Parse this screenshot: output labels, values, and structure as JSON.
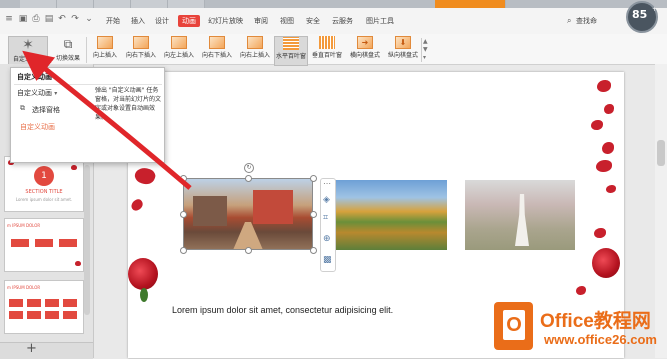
{
  "titlebar": {
    "tabs": [
      "",
      "",
      "",
      "",
      "",
      ""
    ]
  },
  "quick_access": {
    "icons": [
      "menu-icon",
      "save-icon",
      "print-icon",
      "preview-icon",
      "undo-icon",
      "redo-icon",
      "more-icon"
    ]
  },
  "menu": {
    "items": [
      "开始",
      "插入",
      "设计",
      "动画",
      "幻灯片放映",
      "审阅",
      "视图",
      "安全",
      "云服务",
      "图片工具"
    ],
    "active": "动画",
    "search_label": "查找命"
  },
  "badge": {
    "value": "85",
    "unit": "+"
  },
  "ribbon": {
    "custom_anim": "自定义动画",
    "transition": "切换效果",
    "effects": [
      "向上插入",
      "向右下插入",
      "向左上插入",
      "向右下插入",
      "向右上插入",
      "水平百叶窗",
      "垂直百叶窗",
      "横向棋盘式",
      "纵向棋盘式"
    ]
  },
  "popup": {
    "title": "自定义动画",
    "dropdown_label": "自定义动画",
    "pane_option": "选择窗格",
    "link": "自定义动画",
    "description": "弹出 \"自定义动画\" 任务窗格，对当前幻灯片的文字或对象设置自动画效果。"
  },
  "thumbs": {
    "section_num": "1",
    "section_title": "SECTION TITLE",
    "lorem": "Lorem ipsum dolor sit amet.",
    "ipsum": "m IPSUM DOLOR"
  },
  "slide": {
    "body_text": "Lorem ipsum dolor sit amet, consectetur adipisicing elit."
  },
  "float_tools": {
    "icons": [
      "more-icon",
      "layers-icon",
      "crop-icon",
      "zoom-icon",
      "picture-icon"
    ]
  },
  "leftpanel": {
    "add": "+"
  },
  "watermark": {
    "line1": "Office教程网",
    "line2": "www.office26.com"
  },
  "colors": {
    "accent": "#e8433b",
    "rose": "#c8202c",
    "watermark": "#ea6d19"
  }
}
